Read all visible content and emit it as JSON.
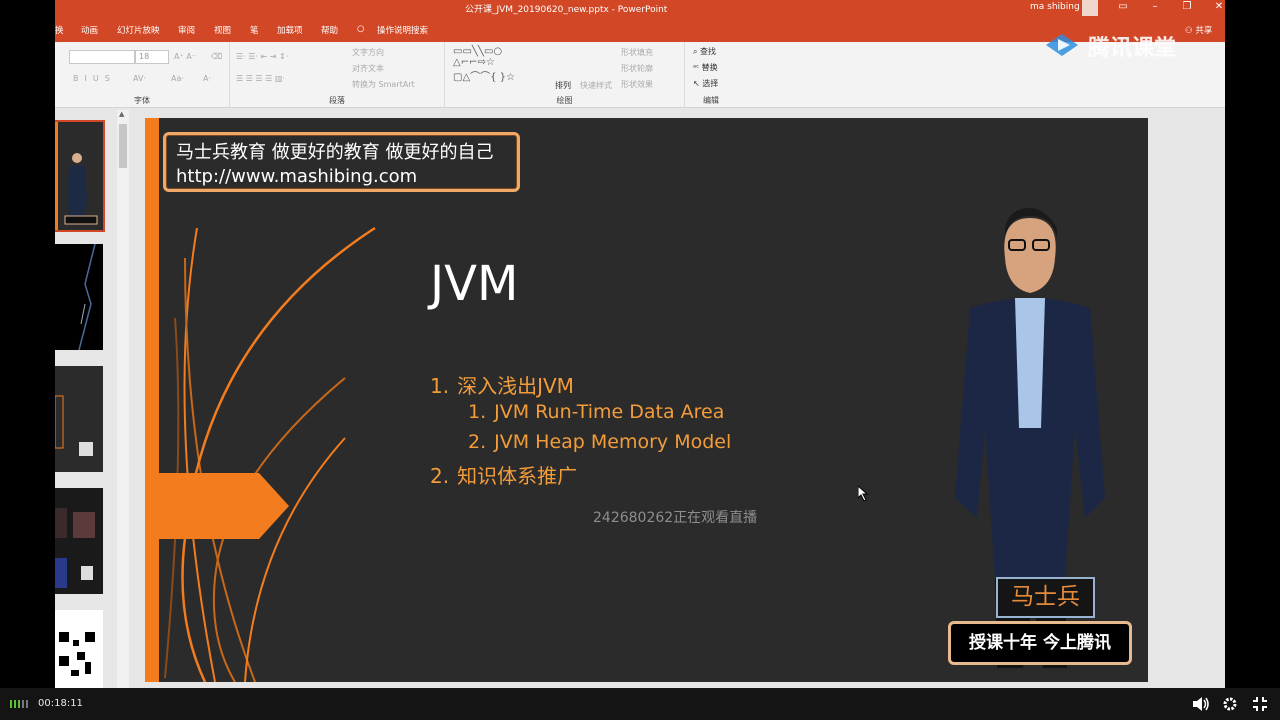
{
  "window": {
    "title": "公开课_JVM_20190620_new.pptx  -  PowerPoint",
    "user": "ma shibing",
    "share_label": "共享"
  },
  "ribbon_tabs": [
    "换",
    "动画",
    "幻灯片放映",
    "审阅",
    "视图",
    "笔",
    "加载项",
    "帮助",
    "操作说明搜索"
  ],
  "ribbon": {
    "font_size": "18",
    "groups": {
      "font": "字体",
      "paragraph": "段落",
      "drawing": "绘图",
      "editing": "编辑"
    },
    "paragraph_items": [
      "文字方向",
      "对齐文本",
      "转换为 SmartArt"
    ],
    "drawing_items": [
      "排列",
      "快速样式",
      "形状填充",
      "形状轮廓",
      "形状效果"
    ],
    "editing_items": [
      "查找",
      "替换",
      "选择"
    ]
  },
  "watermark": {
    "text": "腾讯课堂"
  },
  "slide": {
    "brand_line1": "马士兵教育 做更好的教育 做更好的自己",
    "brand_line2": "http://www.mashibing.com",
    "title": "JVM",
    "agenda": [
      {
        "num": "1.",
        "text": "深入浅出JVM",
        "level": 1
      },
      {
        "num": "1.",
        "text": "JVM Run-Time Data Area",
        "level": 2
      },
      {
        "num": "2.",
        "text": "JVM Heap Memory Model",
        "level": 2
      },
      {
        "num": "2.",
        "text": "知识体系推广",
        "level": 1
      }
    ],
    "viewers": "242680262正在观看直播",
    "name": "马士兵",
    "tagline": "授课十年 今上腾讯",
    "accent_color": "#f39c3a"
  },
  "player": {
    "time": "00:18:11"
  }
}
